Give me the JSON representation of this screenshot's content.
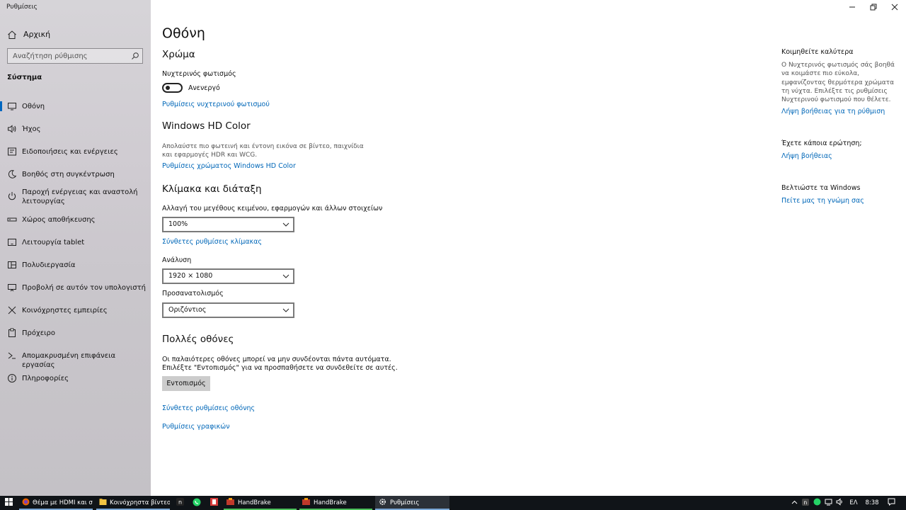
{
  "window": {
    "title": "Ρυθμίσεις",
    "controls": {
      "minimize": "minimize",
      "restore": "restore",
      "close": "close"
    }
  },
  "sidebar": {
    "home_label": "Αρχική",
    "search_placeholder": "Αναζήτηση ρύθμισης",
    "section_heading": "Σύστημα",
    "items": [
      {
        "label": "Οθόνη",
        "icon": "monitor-icon",
        "active": true
      },
      {
        "label": "Ήχος",
        "icon": "speaker-icon"
      },
      {
        "label": "Ειδοποιήσεις και ενέργειες",
        "icon": "notification-icon"
      },
      {
        "label": "Βοηθός στη συγκέντρωση",
        "icon": "moon-icon"
      },
      {
        "label": "Παροχή ενέργειας και αναστολή λειτουργίας",
        "icon": "power-icon"
      },
      {
        "label": "Χώρος αποθήκευσης",
        "icon": "storage-icon"
      },
      {
        "label": "Λειτουργία tablet",
        "icon": "tablet-icon"
      },
      {
        "label": "Πολυδιεργασία",
        "icon": "multitasking-icon"
      },
      {
        "label": "Προβολή σε αυτόν τον υπολογιστή",
        "icon": "projecting-icon"
      },
      {
        "label": "Κοινόχρηστες εμπειρίες",
        "icon": "shared-experiences-icon"
      },
      {
        "label": "Πρόχειρο",
        "icon": "clipboard-icon"
      },
      {
        "label": "Απομακρυσμένη επιφάνεια εργασίας",
        "icon": "remote-desktop-icon"
      },
      {
        "label": "Πληροφορίες",
        "icon": "info-icon"
      }
    ]
  },
  "main": {
    "page_title": "Οθόνη",
    "color": {
      "heading": "Χρώμα",
      "night_light_label": "Νυχτερινός φωτισμός",
      "night_light_state": "Ανενεργό",
      "night_light_settings_link": "Ρυθμίσεις νυχτερινού φωτισμού"
    },
    "hdr": {
      "heading": "Windows HD Color",
      "description": "Απολαύστε πιο φωτεινή και έντονη εικόνα σε βίντεο, παιχνίδια και εφαρμογές HDR και WCG.",
      "link": "Ρυθμίσεις χρώματος Windows HD Color"
    },
    "scale": {
      "heading": "Κλίμακα και διάταξη",
      "size_label": "Αλλαγή του μεγέθους κειμένου, εφαρμογών και άλλων στοιχείων",
      "size_value": "100%",
      "advanced_link": "Σύνθετες ρυθμίσεις κλίμακας",
      "resolution_label": "Ανάλυση",
      "resolution_value": "1920 × 1080",
      "orientation_label": "Προσανατολισμός",
      "orientation_value": "Οριζόντιος"
    },
    "multi": {
      "heading": "Πολλές οθόνες",
      "line1": "Οι παλαιότερες οθόνες μπορεί να μην συνδέονται πάντα αυτόματα.",
      "line2": "Επιλέξτε \"Εντοπισμός\" για να προσπαθήσετε να συνδεθείτε σε αυτές.",
      "detect_button": "Εντοπισμός",
      "advanced_display_link": "Σύνθετες ρυθμίσεις οθόνης",
      "graphics_link": "Ρυθμίσεις γραφικών"
    }
  },
  "aside": {
    "sleep_heading": "Κοιμηθείτε καλύτερα",
    "sleep_text": "Ο Νυχτερινός φωτισμός σάς βοηθά να κοιμάστε πιο εύκολα, εμφανίζοντας θερμότερα χρώματα τη νύχτα. Επιλέξτε τις ρυθμίσεις Νυχτερινού φωτισμού που θέλετε.",
    "sleep_link": "Λήψη βοήθειας για τη ρύθμιση",
    "question_heading": "Έχετε κάποια ερώτηση;",
    "question_link": "Λήψη βοήθειας",
    "improve_heading": "Βελτιώστε τα Windows",
    "improve_link": "Πείτε μας τη γνώμη σας"
  },
  "taskbar": {
    "items": [
      {
        "label": "Θέμα με HDMI και συ...",
        "icon": "firefox-icon"
      },
      {
        "label": "Κοινόχρηστα βίντεο",
        "icon": "folder-icon"
      },
      {
        "label": "",
        "icon": "app-n-icon"
      },
      {
        "label": "",
        "icon": "whatsapp-icon"
      },
      {
        "label": "",
        "icon": "app-red-icon"
      },
      {
        "label": "HandBrake",
        "icon": "handbrake-icon"
      },
      {
        "label": "HandBrake",
        "icon": "handbrake-icon"
      },
      {
        "label": "Ρυθμίσεις",
        "icon": "gear-icon"
      }
    ],
    "language": "ΕΛ",
    "clock": "8:38"
  },
  "colors": {
    "accent": "#0067b8",
    "active_bar": "#0067c0",
    "taskbar": "#101418"
  }
}
